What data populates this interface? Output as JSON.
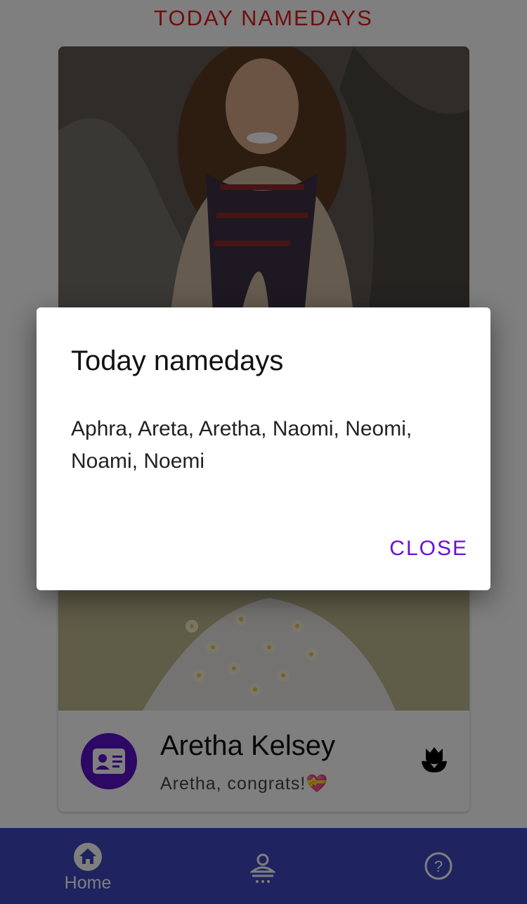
{
  "header": {
    "title": "TODAY NAMEDAYS"
  },
  "card": {
    "name": "Aretha Kelsey",
    "message": "Aretha, congrats!💝"
  },
  "dialog": {
    "title": "Today namedays",
    "body": "Aphra, Areta, Aretha, Naomi, Neomi, Noami, Noemi",
    "close_label": "CLOSE"
  },
  "bottom_nav": {
    "items": [
      {
        "label": "Home",
        "icon": "home-icon"
      },
      {
        "label": "",
        "icon": "person-icon"
      },
      {
        "label": "",
        "icon": "help-icon"
      }
    ]
  },
  "colors": {
    "title_red": "#e21b1b",
    "accent_purple": "#5a10c8",
    "nav_blue": "#3f46c0",
    "close_purple": "#6a10d8"
  }
}
